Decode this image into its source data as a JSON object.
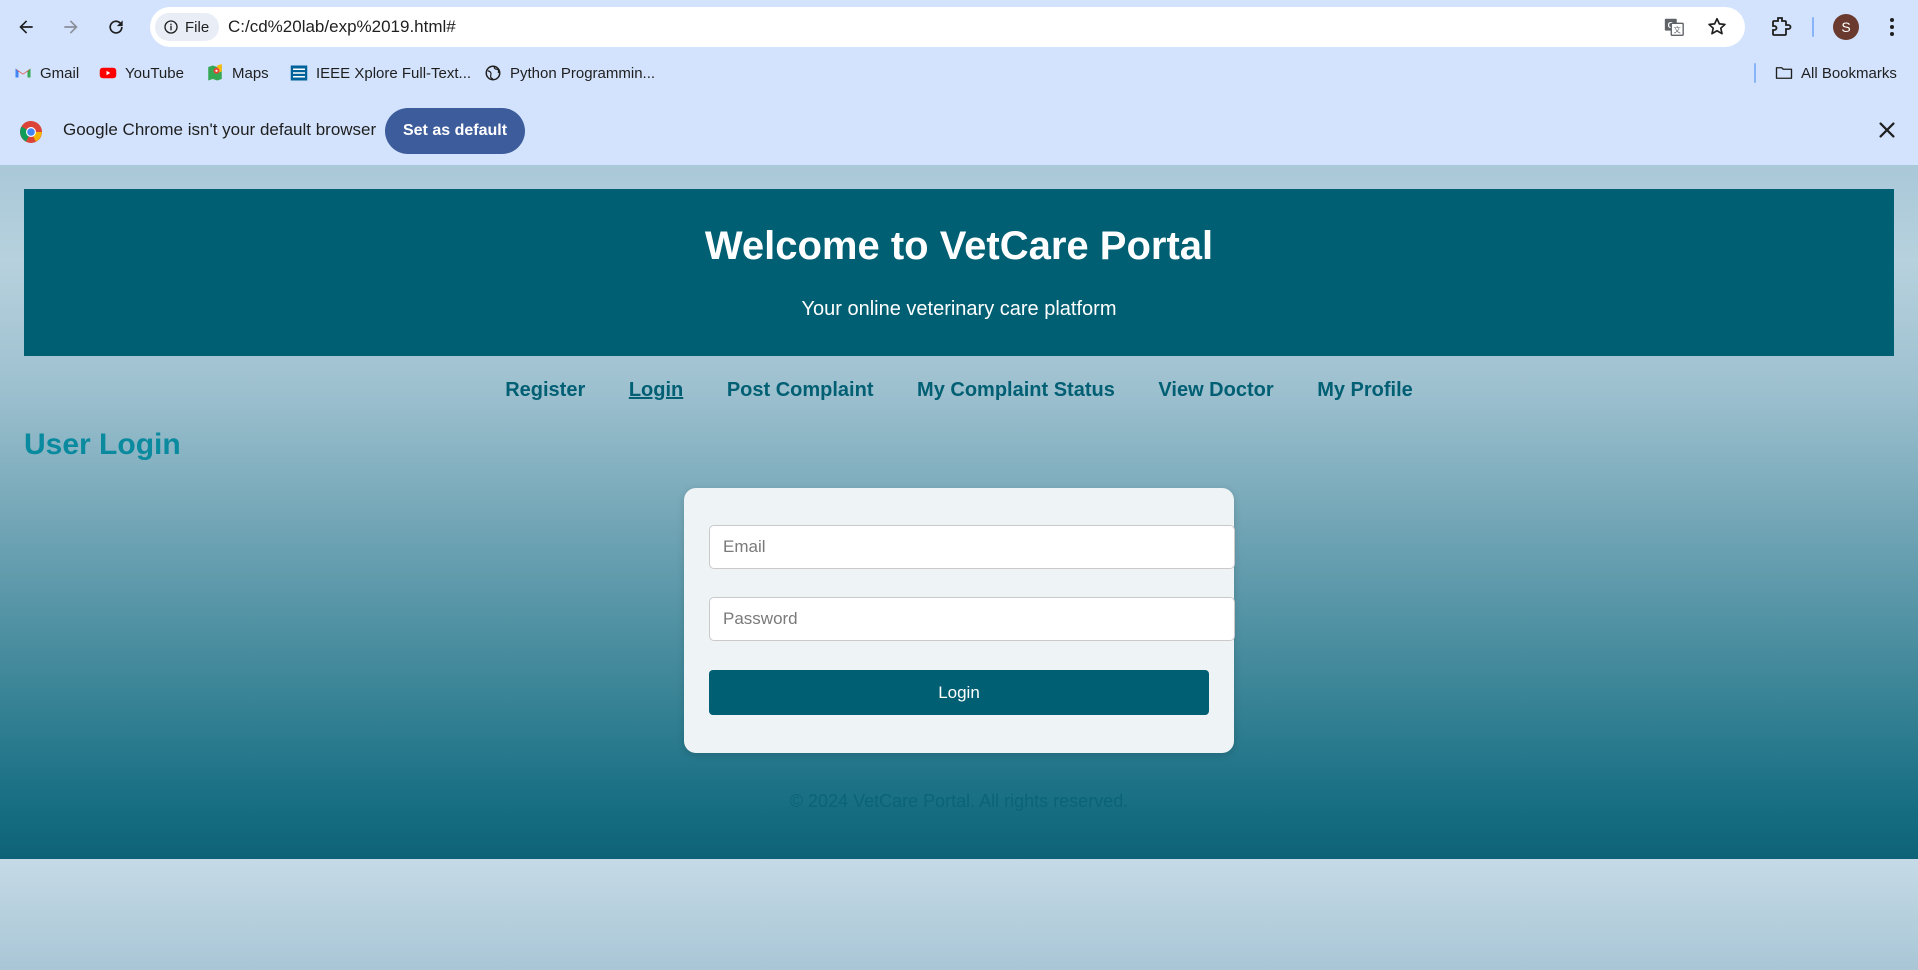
{
  "browser": {
    "site_chip": "File",
    "url": "C:/cd%20lab/exp%2019.html#",
    "avatar_letter": "S",
    "bookmarks": [
      {
        "label": "Gmail",
        "icon": "gmail-icon"
      },
      {
        "label": "YouTube",
        "icon": "youtube-icon"
      },
      {
        "label": "Maps",
        "icon": "maps-icon"
      },
      {
        "label": "IEEE Xplore Full-Text...",
        "icon": "ieee-icon"
      },
      {
        "label": "Python Programmin...",
        "icon": "globe-icon"
      }
    ],
    "all_bookmarks": "All Bookmarks",
    "infobar_message": "Google Chrome isn't your default browser",
    "set_default_label": "Set as default"
  },
  "page": {
    "title": "Welcome to VetCare Portal",
    "subtitle": "Your online veterinary care platform",
    "nav": [
      {
        "label": "Register",
        "active": false
      },
      {
        "label": "Login",
        "active": true
      },
      {
        "label": "Post Complaint",
        "active": false
      },
      {
        "label": "My Complaint Status",
        "active": false
      },
      {
        "label": "View Doctor",
        "active": false
      },
      {
        "label": "My Profile",
        "active": false
      }
    ],
    "section_title": "User Login",
    "form": {
      "email_placeholder": "Email",
      "email_value": "",
      "password_placeholder": "Password",
      "password_value": "",
      "submit_label": "Login"
    },
    "footer": "© 2024 VetCare Portal. All rights reserved."
  },
  "colors": {
    "brand": "#005f73",
    "chrome_bg": "#d3e3fd",
    "section_title": "#0a8a9e"
  }
}
